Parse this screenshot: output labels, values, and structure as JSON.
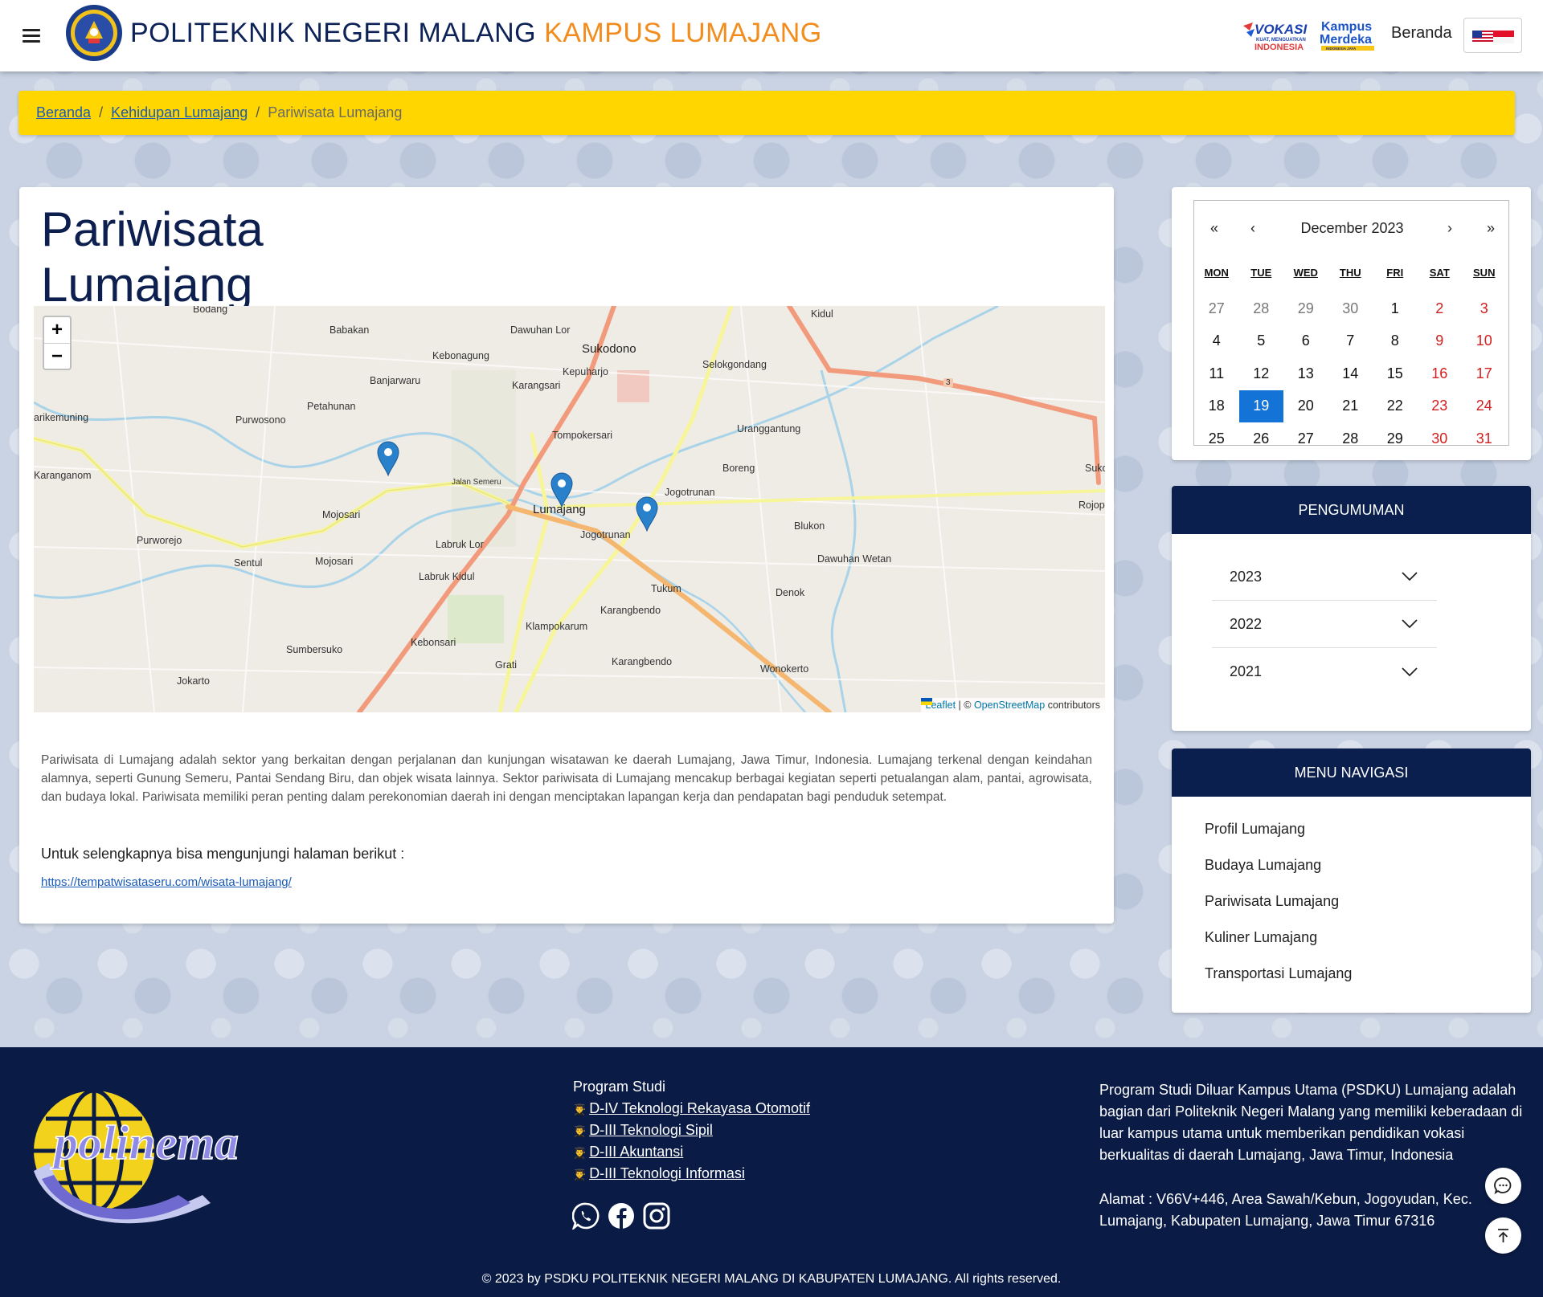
{
  "header": {
    "brand_main": "POLITEKNIK NEGERI MALANG",
    "brand_accent": "KAMPUS LUMAJANG",
    "vokasi_logo_text": "VOKASI KUAT, MENGUATKAN INDONESIA",
    "merdeka_logo_text": "Kampus Merdeka INDONESIA JAYA",
    "nav_beranda": "Beranda"
  },
  "breadcrumb": {
    "home": "Beranda",
    "parent": "Kehidupan Lumajang",
    "current": "Pariwisata Lumajang",
    "separator": "/"
  },
  "main": {
    "title": "Pariwisata Lumajang",
    "description": "Pariwisata di Lumajang adalah sektor yang berkaitan dengan perjalanan dan kunjungan wisatawan ke daerah Lumajang, Jawa Timur, Indonesia. Lumajang terkenal dengan keindahan alamnya, seperti Gunung Semeru, Pantai Sendang Biru, dan objek wisata lainnya. Sektor pariwisata di Lumajang mencakup berbagai kegiatan seperti petualangan alam, pantai, agrowisata, dan budaya lokal. Pariwisata memiliki peran penting dalam perekonomian daerah ini dengan menciptakan lapangan kerja dan pendapatan bagi penduduk setempat.",
    "more_text": "Untuk selengkapnya bisa mengunjungi halaman berikut :",
    "more_link": "https://tempatwisataseru.com/wisata-lumajang/"
  },
  "map": {
    "zoom_in": "+",
    "zoom_out": "−",
    "attribution_leaflet": "Leaflet",
    "attribution_sep": "| ©",
    "attribution_osm": "OpenStreetMap",
    "attribution_tail": "contributors",
    "labels": {
      "bodang": "Bodang",
      "babakan": "Babakan",
      "dawuhan_lor": "Dawuhan Lor",
      "kidul": "Kidul",
      "sukodono": "Sukodono",
      "kebonagung": "Kebonagung",
      "kepuharjo": "Kepuharjo",
      "selokgondang": "Selokgondang",
      "banjarwaru": "Banjarwaru",
      "karangsari": "Karangsari",
      "petahunan": "Petahunan",
      "purwosono": "Purwosono",
      "arikemuning": "arikemuning",
      "uranggantung": "Uranggantung",
      "tompokersari": "Tompokersari",
      "boreng": "Boreng",
      "karanganom": "Karanganom",
      "jalan_semeru": "Jalan Semeru",
      "jogotrunan": "Jogotrunan",
      "suko": "Suko",
      "mojosari": "Mojosari",
      "lumajang": "Lumajang",
      "rojopo": "Rojopo",
      "blukon": "Blukon",
      "jogotrunan2": "Jogotrunan",
      "purworejo": "Purworejo",
      "labruk_lor": "Labruk Lor",
      "sentul": "Sentul",
      "mojosari2": "Mojosari",
      "dawuhan_wetan": "Dawuhan Wetan",
      "labruk_kidul": "Labruk Kidul",
      "tukum": "Tukum",
      "denok": "Denok",
      "karangbendo": "Karangbendo",
      "klampokarum": "Klampokarum",
      "kebonsari": "Kebonsari",
      "sumbersuko": "Sumbersuko",
      "grati": "Grati",
      "karangbendo2": "Karangbendo",
      "wonokerto": "Wonokerto",
      "jokarto": "Jokarto",
      "route_3": "3"
    }
  },
  "calendar": {
    "prev_year": "«",
    "prev_month": "‹",
    "month_label": "December 2023",
    "next_month": "›",
    "next_year": "»",
    "weekdays": [
      "MON",
      "TUE",
      "WED",
      "THU",
      "FRI",
      "SAT",
      "SUN"
    ],
    "weeks": [
      [
        "27",
        "28",
        "29",
        "30",
        "1",
        "2",
        "3"
      ],
      [
        "4",
        "5",
        "6",
        "7",
        "8",
        "9",
        "10"
      ],
      [
        "11",
        "12",
        "13",
        "14",
        "15",
        "16",
        "17"
      ],
      [
        "18",
        "19",
        "20",
        "21",
        "22",
        "23",
        "24"
      ],
      [
        "25",
        "26",
        "27",
        "28",
        "29",
        "30",
        "31"
      ]
    ],
    "today": "19"
  },
  "pengumuman": {
    "title": "PENGUMUMAN",
    "years": [
      "2023",
      "2022",
      "2021"
    ]
  },
  "menu": {
    "title": "MENU NAVIGASI",
    "items": [
      "Profil Lumajang",
      "Budaya Lumajang",
      "Pariwisata Lumajang",
      "Kuliner Lumajang",
      "Transportasi Lumajang"
    ]
  },
  "footer": {
    "logo_text": "polinema",
    "program_title": "Program Studi",
    "programs": [
      "D-IV Teknologi Rekayasa Otomotif",
      "D-III Teknologi Sipil",
      "D-III Akuntansi",
      "D-III Teknologi Informasi"
    ],
    "about": "Program Studi Diluar Kampus Utama (PSDKU) Lumajang adalah bagian dari Politeknik Negeri Malang yang memiliki keberadaan di luar kampus utama untuk memberikan pendidikan vokasi berkualitas di daerah Lumajang, Jawa Timur, Indonesia",
    "address": "Alamat : V66V+446, Area Sawah/Kebun, Jogoyudan, Kec. Lumajang, Kabupaten Lumajang, Jawa Timur 67316",
    "copyright": "© 2023 by PSDKU POLITEKNIK NEGERI MALANG DI KABUPATEN LUMAJANG. All rights reserved."
  },
  "colors": {
    "navy": "#0a1f4e",
    "accent_orange": "#f28c1c",
    "breadcrumb_yellow": "#ffd600",
    "today_blue": "#1473d6",
    "weekend_red": "#d21e1e"
  }
}
